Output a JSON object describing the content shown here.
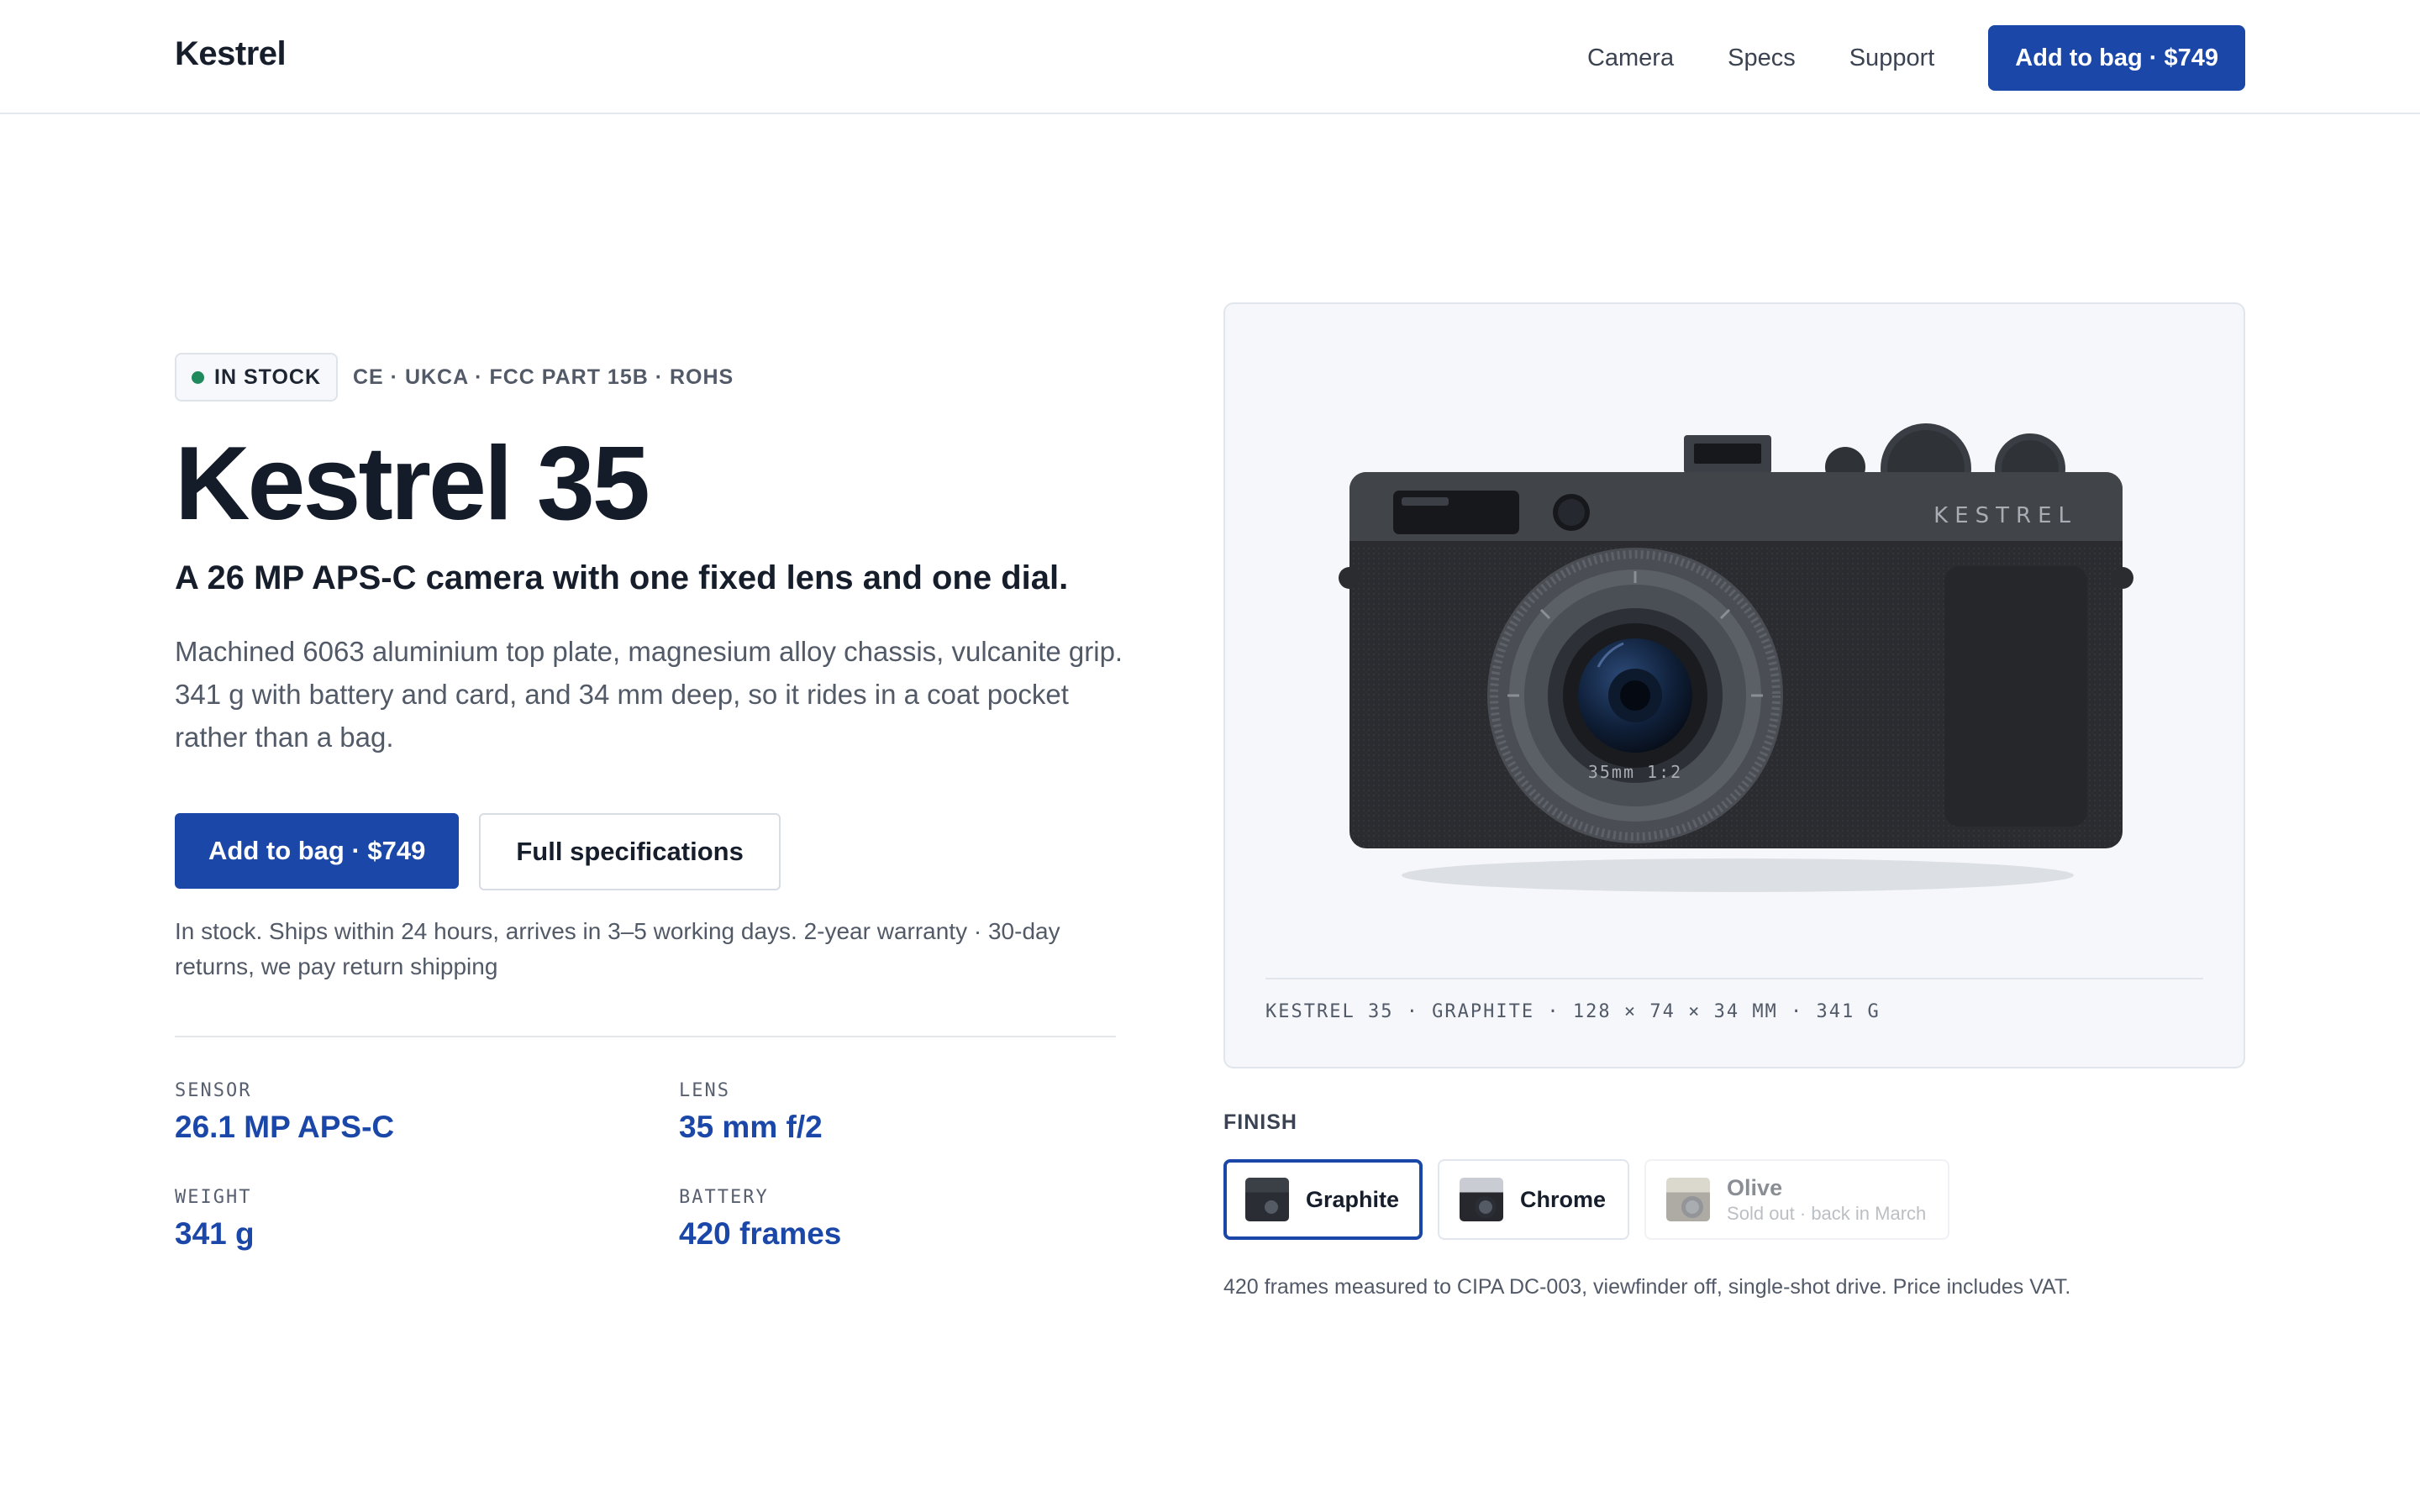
{
  "header": {
    "brand": "Kestrel",
    "nav": [
      "Camera",
      "Specs",
      "Support"
    ],
    "cta": "Add to bag · $749"
  },
  "product": {
    "badge": "IN STOCK",
    "certifications": "CE · UKCA · FCC PART 15B · ROHS",
    "title": "Kestrel 35",
    "subtitle": "A 26 MP APS-C camera with one fixed lens and one dial.",
    "description": "Machined 6063 aluminium top plate, magnesium alloy chassis, vulcanite grip. 341 g with battery and card, and 34 mm deep, so it rides in a coat pocket rather than a bag.",
    "primary_cta": "Add to bag · $749",
    "secondary_cta": "Full specifications",
    "shipping_note": "In stock. Ships within 24 hours, arrives in 3–5 working days. 2-year warranty · 30-day returns, we pay return shipping"
  },
  "specs": [
    {
      "label": "SENSOR",
      "value": "26.1 MP APS-C"
    },
    {
      "label": "LENS",
      "value": "35 mm f/2"
    },
    {
      "label": "WEIGHT",
      "value": "341 g"
    },
    {
      "label": "BATTERY",
      "value": "420 frames"
    }
  ],
  "media": {
    "engraving": "KESTREL",
    "lens_marking": "35mm 1:2",
    "caption": "KESTREL 35 · GRAPHITE · 128 × 74 × 34 MM · 341 G"
  },
  "finish": {
    "label": "FINISH",
    "options": [
      {
        "name": "Graphite",
        "sub": "",
        "selected": true,
        "available": true,
        "top_color": "#3b3f46",
        "body_color": "#2a2d33"
      },
      {
        "name": "Chrome",
        "sub": "",
        "selected": false,
        "available": true,
        "top_color": "#c9ccd2",
        "body_color": "#26282d"
      },
      {
        "name": "Olive",
        "sub": "Sold out · back in March",
        "selected": false,
        "available": false,
        "top_color": "#b8b29c",
        "body_color": "#5d5a49"
      }
    ],
    "note": "420 frames measured to CIPA DC-003, viewfinder off, single-shot drive. Price includes VAT."
  },
  "colors": {
    "accent": "#1a47a8",
    "in_stock": "#1f8a5b",
    "text": "#161d2b",
    "muted": "#525a68"
  }
}
